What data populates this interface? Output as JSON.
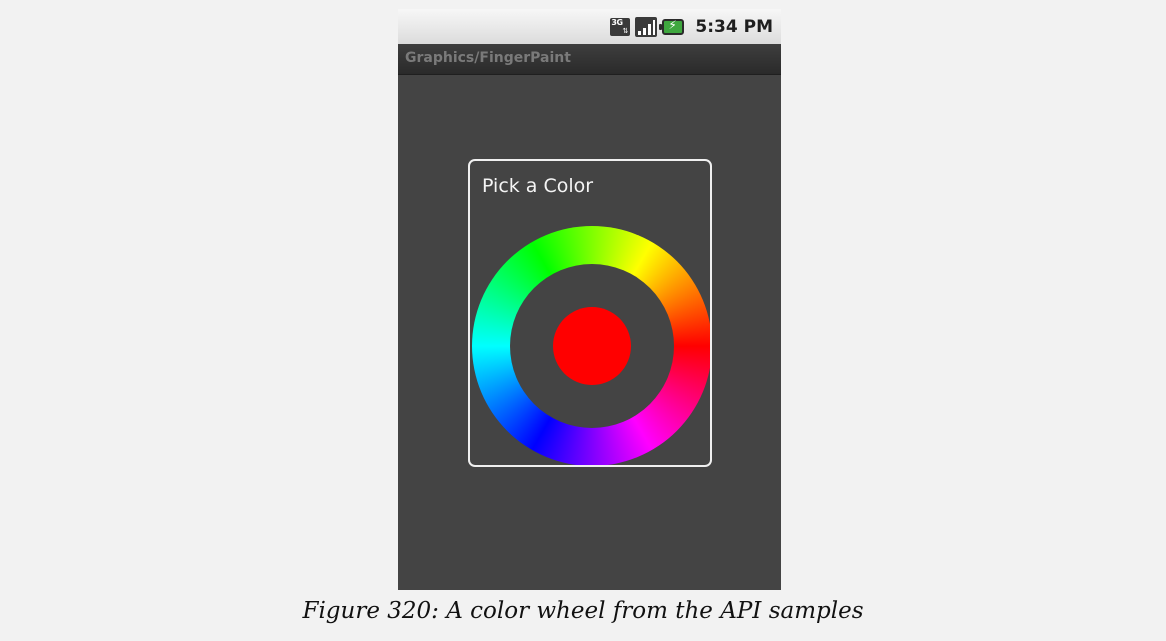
{
  "status_bar": {
    "network_label": "3G",
    "time": "5:34 PM"
  },
  "app": {
    "title": "Graphics/FingerPaint"
  },
  "dialog": {
    "title": "Pick a Color",
    "selected_color": "#ff0000",
    "wheel_colors": [
      "#ff0000",
      "#ff00ff",
      "#0000ff",
      "#00ffff",
      "#00ff00",
      "#ffff00",
      "#ff0000"
    ]
  },
  "caption": "Figure 320: A color wheel from the API samples"
}
